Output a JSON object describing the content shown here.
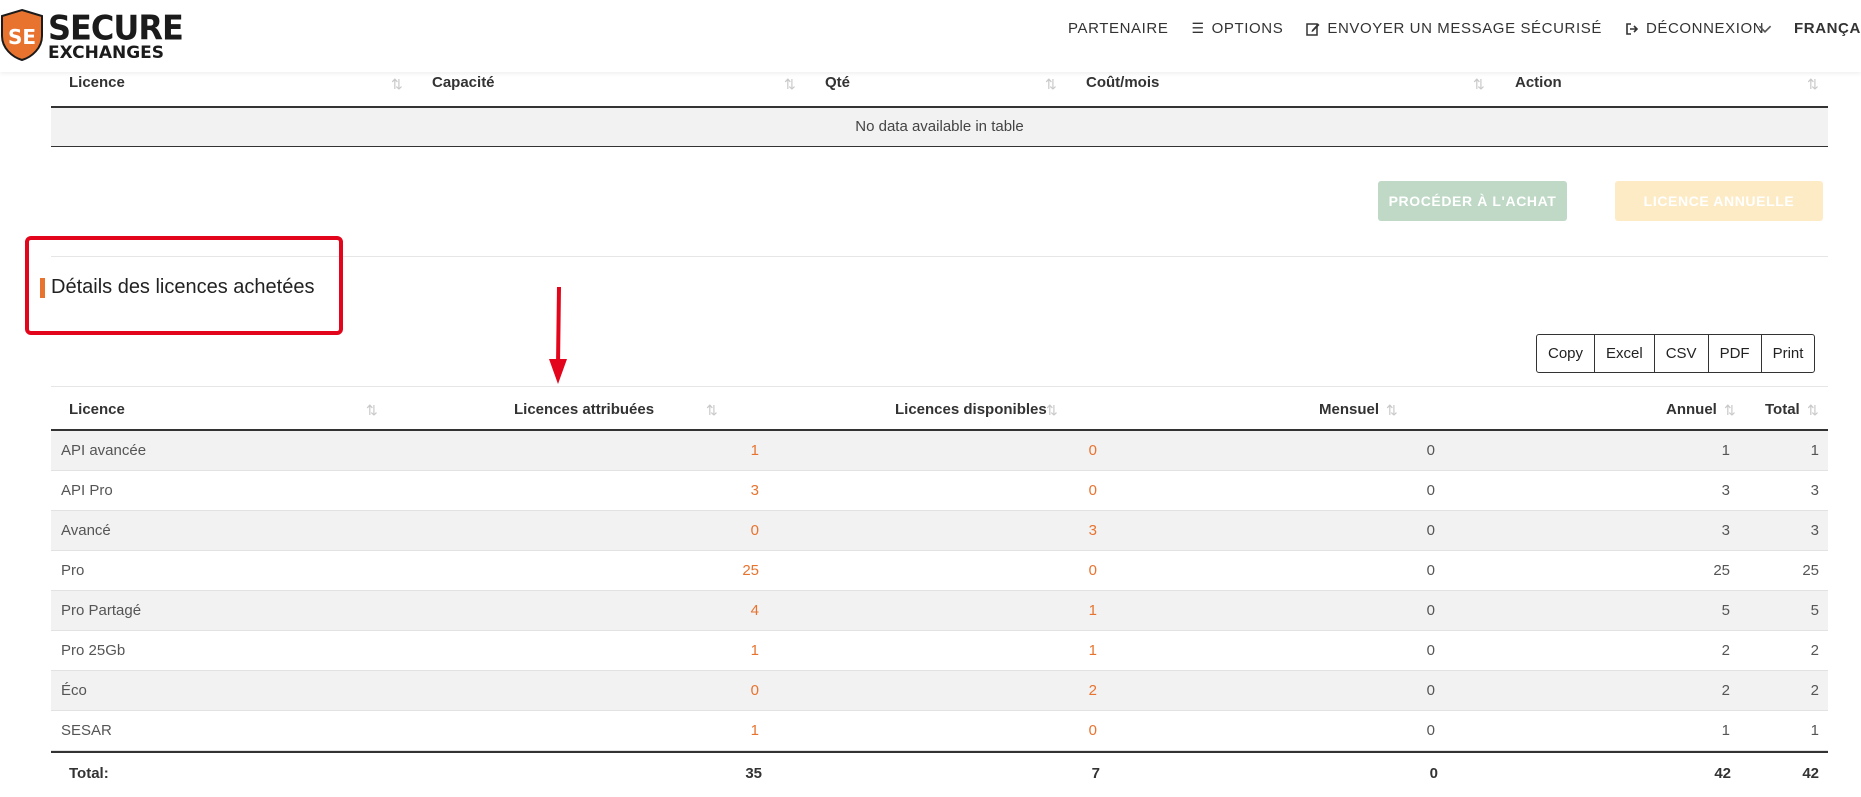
{
  "header": {
    "logo_line1": "SECURE",
    "logo_line2": "EXCHANGES",
    "logo_mark": "SE",
    "nav": {
      "partner": "PARTENAIRE",
      "options": "OPTIONS",
      "send_message": "ENVOYER UN MESSAGE SÉCURISÉ",
      "logout": "DÉCONNEXION",
      "language": "FRANÇA"
    }
  },
  "cart_table": {
    "columns": [
      "Licence",
      "Capacité",
      "Qté",
      "Coût/mois",
      "Action"
    ],
    "empty_message": "No data available in table"
  },
  "buttons": {
    "purchase": "PROCÉDER À L'ACHAT",
    "annual": "LICENCE ANNUELLE"
  },
  "section": {
    "title": "Détails des licences achetées"
  },
  "export_buttons": [
    "Copy",
    "Excel",
    "CSV",
    "PDF",
    "Print"
  ],
  "licences_table": {
    "columns": [
      "Licence",
      "Licences attribuées",
      "Licences disponibles",
      "Mensuel",
      "Annuel",
      "Total"
    ],
    "rows": [
      {
        "licence": "API avancée",
        "assigned": "1",
        "available": "0",
        "monthly": "0",
        "annual": "1",
        "total": "1"
      },
      {
        "licence": "API Pro",
        "assigned": "3",
        "available": "0",
        "monthly": "0",
        "annual": "3",
        "total": "3"
      },
      {
        "licence": "Avancé",
        "assigned": "0",
        "available": "3",
        "monthly": "0",
        "annual": "3",
        "total": "3"
      },
      {
        "licence": "Pro",
        "assigned": "25",
        "available": "0",
        "monthly": "0",
        "annual": "25",
        "total": "25"
      },
      {
        "licence": "Pro Partagé",
        "assigned": "4",
        "available": "1",
        "monthly": "0",
        "annual": "5",
        "total": "5"
      },
      {
        "licence": "Pro 25Gb",
        "assigned": "1",
        "available": "1",
        "monthly": "0",
        "annual": "2",
        "total": "2"
      },
      {
        "licence": "Éco",
        "assigned": "0",
        "available": "2",
        "monthly": "0",
        "annual": "2",
        "total": "2"
      },
      {
        "licence": "SESAR",
        "assigned": "1",
        "available": "0",
        "monthly": "0",
        "annual": "1",
        "total": "1"
      }
    ],
    "totals": {
      "label": "Total:",
      "assigned": "35",
      "available": "7",
      "monthly": "0",
      "annual": "42",
      "total": "42"
    }
  },
  "colors": {
    "accent": "#e8732f",
    "annotation": "#e3051b",
    "purchase_button": "#bfd9c6",
    "annual_button": "#fdebc6"
  }
}
